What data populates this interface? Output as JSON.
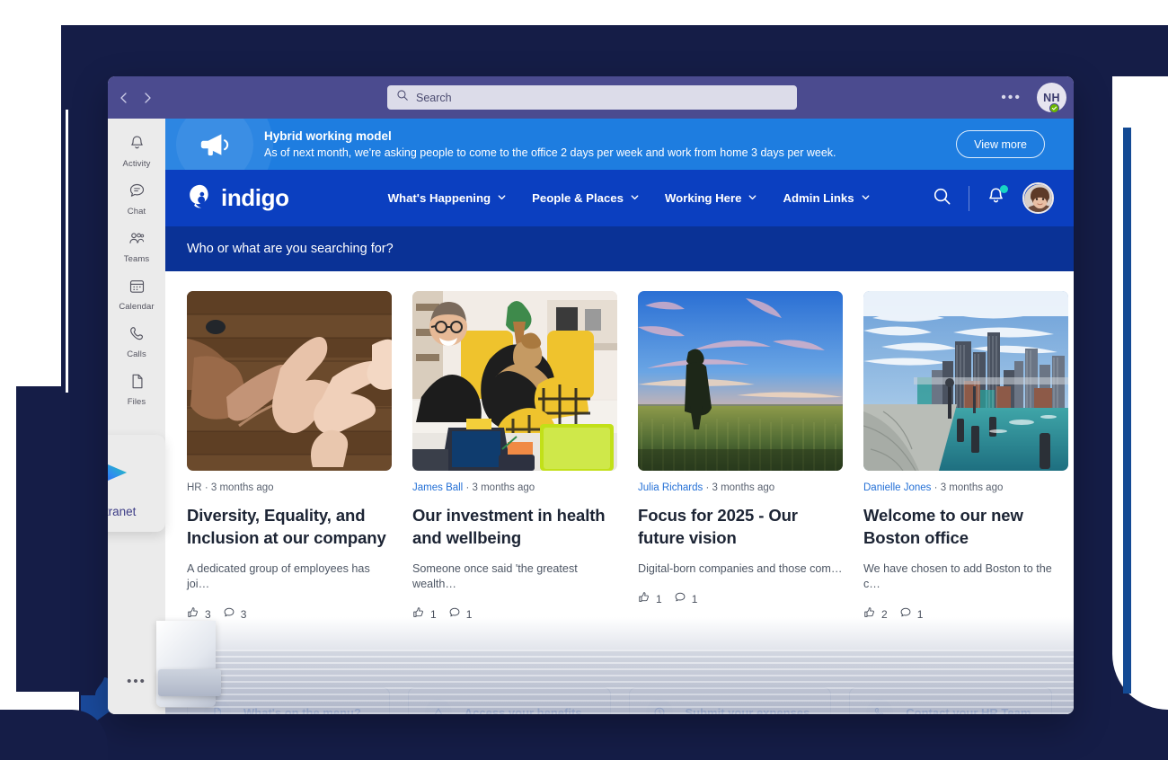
{
  "window": {
    "titlebar": {
      "back_icon": "chevron-left-icon",
      "forward_icon": "chevron-right-icon",
      "search_placeholder": "Search",
      "more_label": "•••",
      "avatar_initials": "NH",
      "presence": "available"
    },
    "rail": {
      "items": [
        {
          "label": "Activity",
          "icon": "bell-icon"
        },
        {
          "label": "Chat",
          "icon": "chat-icon"
        },
        {
          "label": "Teams",
          "icon": "teams-icon"
        },
        {
          "label": "Calendar",
          "icon": "calendar-icon"
        },
        {
          "label": "Calls",
          "icon": "phone-icon"
        },
        {
          "label": "Files",
          "icon": "file-icon"
        }
      ],
      "more_label": "•••",
      "app_card": {
        "label": "My intranet",
        "icon": "intranet-play-logo"
      }
    }
  },
  "banner": {
    "icon": "megaphone-icon",
    "title": "Hybrid working model",
    "description": "As of next month, we're asking people to come to the office 2 days per week and work from home 3 days per week.",
    "cta_label": "View more"
  },
  "brandnav": {
    "logo_text": "indigo",
    "logo_icon": "indigo-swirl-logo",
    "links": [
      {
        "label": "What's Happening",
        "caret": "chevron-down-icon"
      },
      {
        "label": "People & Places",
        "caret": "chevron-down-icon"
      },
      {
        "label": "Working Here",
        "caret": "chevron-down-icon"
      },
      {
        "label": "Admin Links",
        "caret": "chevron-down-icon"
      }
    ],
    "search_icon": "search-icon",
    "bell_icon": "bell-icon",
    "bell_badge": true,
    "avatar": "user-photo"
  },
  "searchband": {
    "prompt": "Who or what are you searching for?"
  },
  "cards": [
    {
      "image": "hands-on-wooden-table",
      "author": "HR",
      "author_is_link": false,
      "time": "3 months ago",
      "separator": "·",
      "title": "Diversity, Equality, and Inclusion at our company",
      "excerpt": "A dedicated group of employees has joi…",
      "likes": "3",
      "comments": "3"
    },
    {
      "image": "two-colleagues-with-laptops",
      "author": "James Ball",
      "author_is_link": true,
      "time": "3 months ago",
      "separator": "·",
      "title": "Our investment in health and wellbeing",
      "excerpt": "Someone once said 'the greatest wealth…",
      "likes": "1",
      "comments": "1"
    },
    {
      "image": "person-in-wheat-field-at-sunset",
      "author": "Julia Richards",
      "author_is_link": true,
      "time": "3 months ago",
      "separator": "·",
      "title": "Focus for 2025 - Our future vision",
      "excerpt": "Digital-born companies and those com…",
      "likes": "1",
      "comments": "1"
    },
    {
      "image": "boston-harbor-skyline",
      "author": "Danielle Jones",
      "author_is_link": true,
      "time": "3 months ago",
      "separator": "·",
      "title": "Welcome to our new Boston office",
      "excerpt": "We have chosen to add Boston to the c…",
      "likes": "2",
      "comments": "1"
    }
  ],
  "quick_links": [
    {
      "label": "What's on the menu?",
      "icon": "document-icon"
    },
    {
      "label": "Access your benefits",
      "icon": "triangle-icon"
    },
    {
      "label": "Submit your expenses",
      "icon": "clock-icon"
    },
    {
      "label": "Contact your HR Team",
      "icon": "phone-icon"
    }
  ],
  "colors": {
    "page_navy": "#151d47",
    "teams_titlebar": "#4b4b8f",
    "banner_blue": "#1e7de0",
    "brand_blue": "#0b3fc0",
    "searchband_blue": "#0a3296",
    "link_blue": "#2470d6",
    "accent_teal": "#17d6c4",
    "presence_green": "#6bb700",
    "rail_grey": "#ebebeb"
  }
}
